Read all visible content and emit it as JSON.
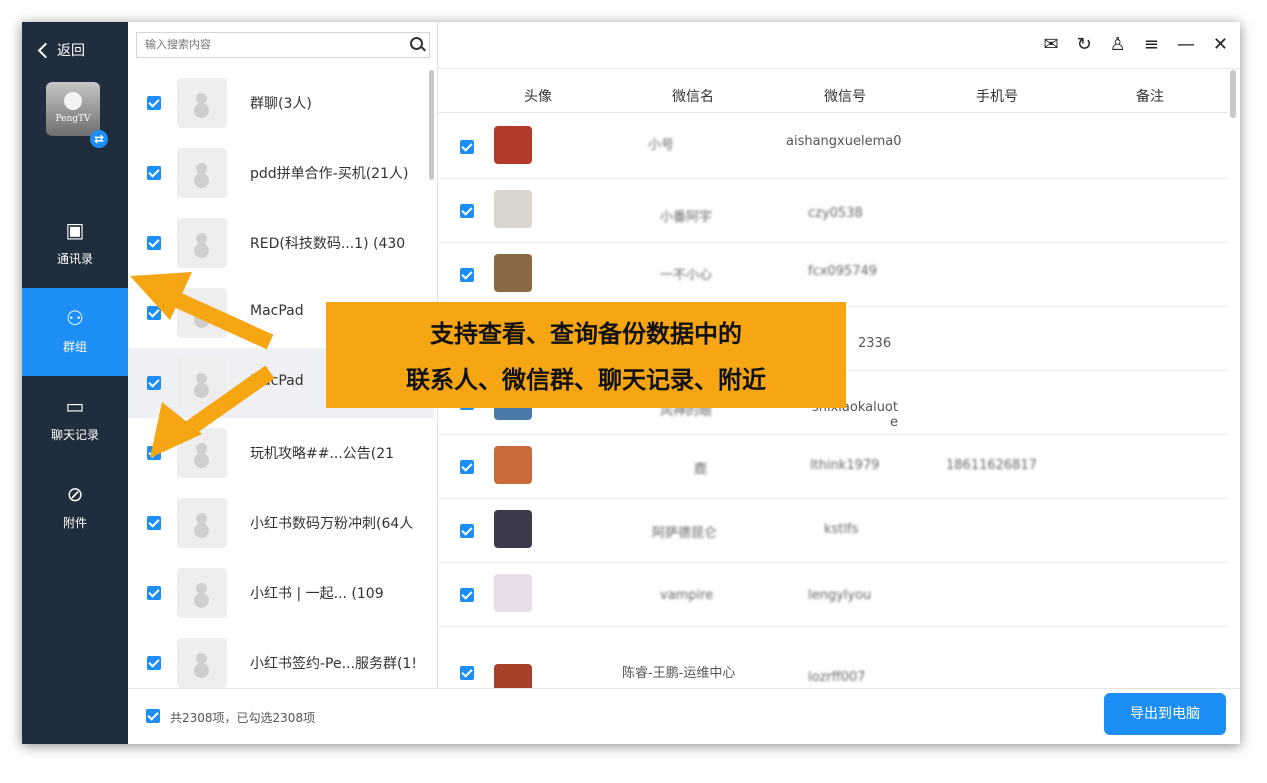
{
  "sidebar": {
    "back_label": "返回",
    "device_label": "PengTV",
    "items": [
      {
        "label": "通讯录",
        "icon": "contacts-icon"
      },
      {
        "label": "群组",
        "icon": "group-icon"
      },
      {
        "label": "聊天记录",
        "icon": "chat-icon"
      },
      {
        "label": "附件",
        "icon": "attachment-icon"
      }
    ],
    "active_index": 1
  },
  "search": {
    "placeholder": "输入搜索内容"
  },
  "groups": [
    {
      "name": "群聊(3人)",
      "checked": true
    },
    {
      "name": "pdd拼单合作-买机(21人)",
      "checked": true
    },
    {
      "name": "RED(科技数码...1) (430",
      "checked": true
    },
    {
      "name": "MacPad",
      "checked": true
    },
    {
      "name": "MacPad",
      "checked": true
    },
    {
      "name": "玩机攻略##...公告(21",
      "checked": true
    },
    {
      "name": "小红书数码万粉冲刺(64人",
      "checked": true
    },
    {
      "name": "小红书 | 一起... (109",
      "checked": true
    },
    {
      "name": "小红书签约-Pe...服务群(1!",
      "checked": true
    }
  ],
  "table": {
    "headers": [
      "头像",
      "微信名",
      "微信号",
      "手机号",
      "备注"
    ],
    "rows": [
      {
        "nickname": "小号",
        "wechat_id": "aishangxuelema0",
        "phone": "",
        "note": "",
        "avatar_color": "#b33a2a"
      },
      {
        "nickname": "小番阿宇",
        "wechat_id": "czy0538",
        "phone": "",
        "note": "",
        "avatar_color": "#d9d4cc"
      },
      {
        "nickname": "一不小心",
        "wechat_id": "fcx095749",
        "phone": "",
        "note": "",
        "avatar_color": "#8a6a44"
      },
      {
        "nickname": "",
        "wechat_id": "2336",
        "phone": "",
        "note": "",
        "avatar_color": "#5a6e8c"
      },
      {
        "nickname": "风神的眼",
        "wechat_id": "shixiaokaluot e",
        "phone": "",
        "note": "",
        "avatar_color": "#4a7aa8"
      },
      {
        "nickname": "鹿",
        "wechat_id": "lthink1979",
        "phone": "18611626817",
        "note": "",
        "avatar_color": "#c86a3a"
      },
      {
        "nickname": "阿萨德昆仑",
        "wechat_id": "kstlfs",
        "phone": "",
        "note": "",
        "avatar_color": "#3a3a4a"
      },
      {
        "nickname": "vampire",
        "wechat_id": "lengylyou",
        "phone": "",
        "note": "",
        "avatar_color": "#e8dde8"
      },
      {
        "nickname": "陈睿-王鹏-运维中心",
        "wechat_id": "lozrff007",
        "phone": "",
        "note": "",
        "avatar_color": "#a8402a"
      }
    ]
  },
  "footer": {
    "summary": "共2308项，已勾选2308项",
    "export_label": "导出到电脑"
  },
  "banner": {
    "line1": "支持查看、查询备份数据中的",
    "line2": "联系人、微信群、聊天记录、附近"
  },
  "window_icons": [
    "mail-icon",
    "refresh-icon",
    "user-icon",
    "menu-icon",
    "minimize-icon",
    "close-icon"
  ],
  "colors": {
    "accent": "#1e8ef7",
    "sidebar": "#1f2d3d",
    "banner": "#f6a612",
    "arrow": "#f6a612"
  }
}
